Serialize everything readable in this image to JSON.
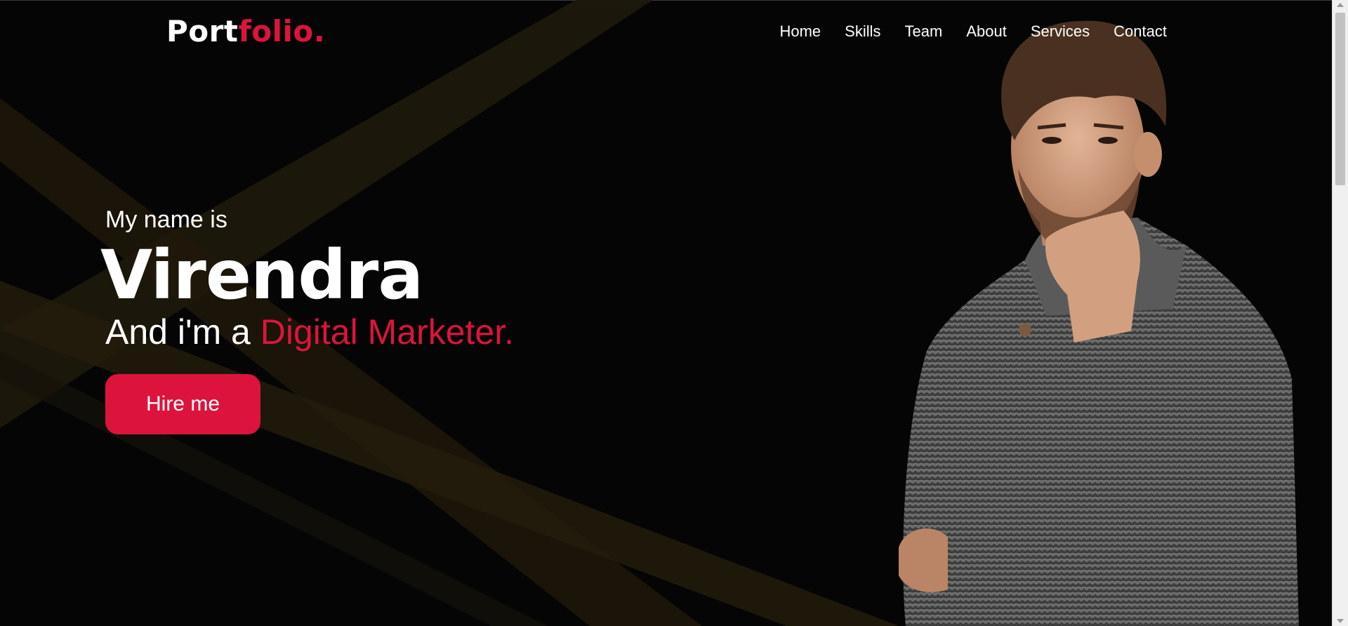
{
  "brand": {
    "logo_main": "Port",
    "logo_accent": "folio."
  },
  "nav": {
    "items": [
      "Home",
      "Skills",
      "Team",
      "About",
      "Services",
      "Contact"
    ]
  },
  "hero": {
    "intro": "My name is",
    "name": "Virendra",
    "role_prefix": "And i'm a ",
    "role_highlight": "Digital Marketer.",
    "cta_label": "Hire me"
  },
  "colors": {
    "background": "#050505",
    "accent": "#dc143c",
    "text": "#ffffff",
    "streak": "#2a2210"
  }
}
